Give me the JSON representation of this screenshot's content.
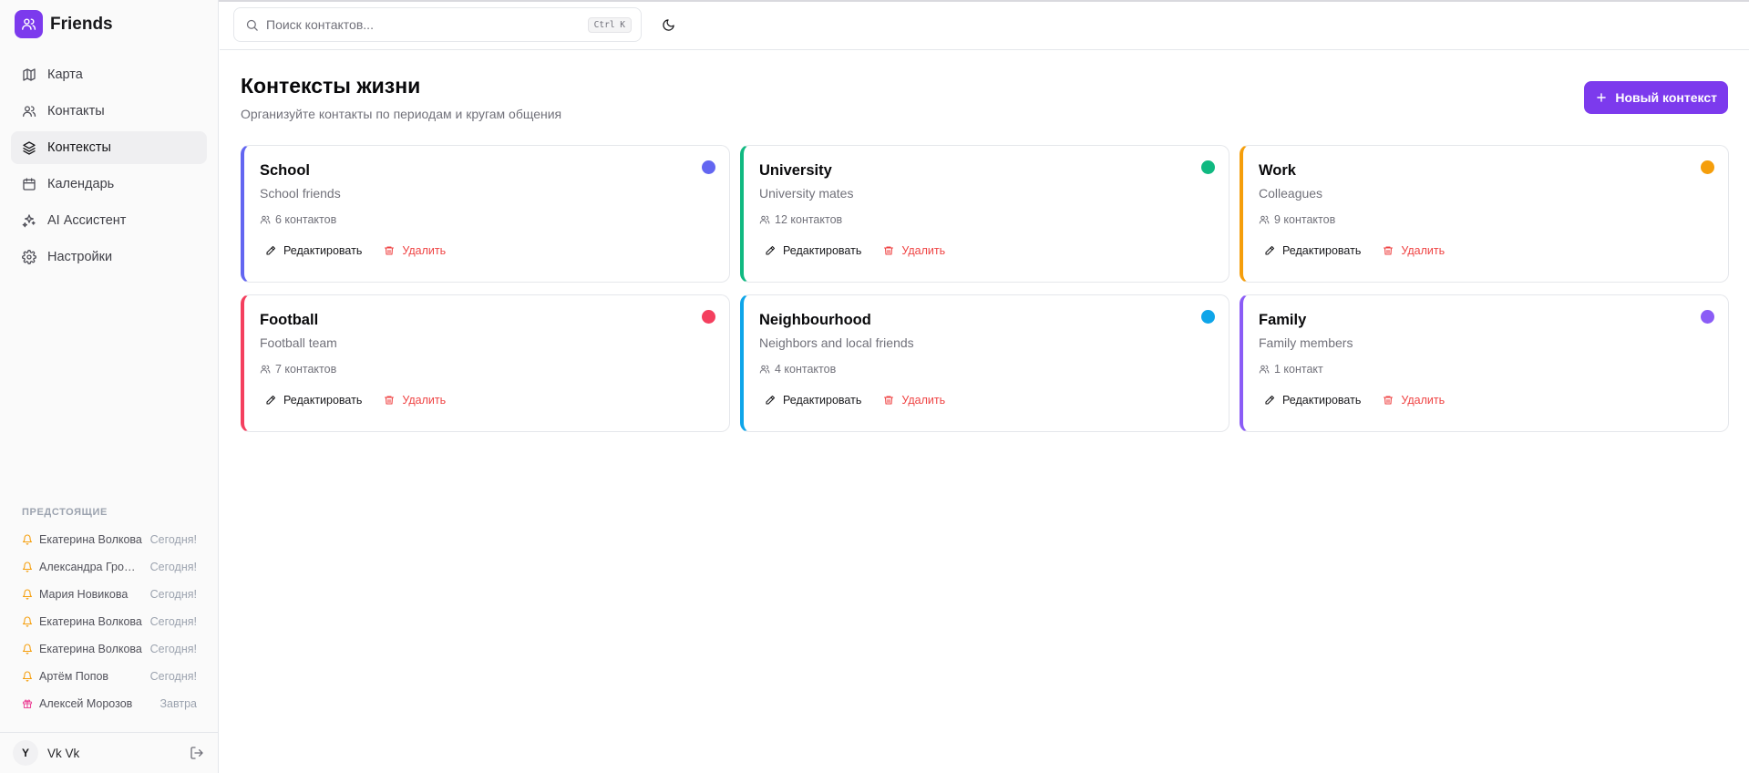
{
  "app": {
    "name": "Friends"
  },
  "colors": {
    "accent": "#7c3aed",
    "danger": "#ef4444"
  },
  "nav": [
    {
      "label": "Карта",
      "icon": "map-icon"
    },
    {
      "label": "Контакты",
      "icon": "users-icon"
    },
    {
      "label": "Контексты",
      "icon": "layers-icon",
      "active": true
    },
    {
      "label": "Календарь",
      "icon": "calendar-icon"
    },
    {
      "label": "AI Ассистент",
      "icon": "sparkles-icon"
    },
    {
      "label": "Настройки",
      "icon": "gear-icon"
    }
  ],
  "upcoming": {
    "title": "ПРЕДСТОЯЩИЕ",
    "items": [
      {
        "name": "Екатерина Волкова",
        "when": "Сегодня!",
        "icon": "bell-icon"
      },
      {
        "name": "Александра Громова",
        "when": "Сегодня!",
        "icon": "bell-icon"
      },
      {
        "name": "Мария Новикова",
        "when": "Сегодня!",
        "icon": "bell-icon"
      },
      {
        "name": "Екатерина Волкова",
        "when": "Сегодня!",
        "icon": "bell-icon"
      },
      {
        "name": "Екатерина Волкова",
        "when": "Сегодня!",
        "icon": "bell-icon"
      },
      {
        "name": "Артём Попов",
        "when": "Сегодня!",
        "icon": "bell-icon"
      },
      {
        "name": "Алексей Морозов",
        "when": "Завтра",
        "icon": "gift-icon"
      }
    ]
  },
  "user": {
    "initial": "Y",
    "name": "Vk Vk"
  },
  "search": {
    "placeholder": "Поиск контактов...",
    "shortcut": "Ctrl K"
  },
  "page": {
    "title": "Контексты жизни",
    "subtitle": "Организуйте контакты по периодам и кругам общения",
    "new_button": "Новый контекст"
  },
  "actions": {
    "edit": "Редактировать",
    "delete": "Удалить"
  },
  "contexts": [
    {
      "title": "School",
      "description": "School friends",
      "count": "6 контактов",
      "color": "#6366f1"
    },
    {
      "title": "University",
      "description": "University mates",
      "count": "12 контактов",
      "color": "#10b981"
    },
    {
      "title": "Work",
      "description": "Colleagues",
      "count": "9 контактов",
      "color": "#f59e0b"
    },
    {
      "title": "Football",
      "description": "Football team",
      "count": "7 контактов",
      "color": "#f43f5e"
    },
    {
      "title": "Neighbourhood",
      "description": "Neighbors and local friends",
      "count": "4 контактов",
      "color": "#0ea5e9"
    },
    {
      "title": "Family",
      "description": "Family members",
      "count": "1 контакт",
      "color": "#8b5cf6"
    }
  ]
}
